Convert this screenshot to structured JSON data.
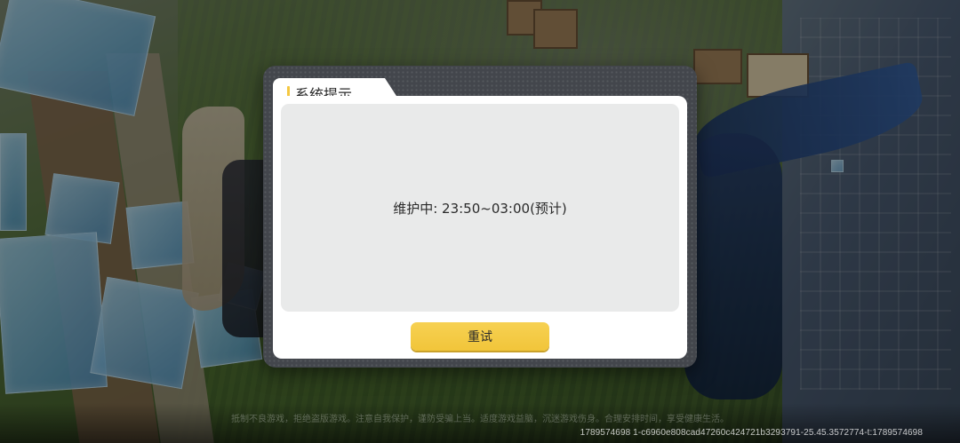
{
  "dialog": {
    "title": "系统提示",
    "message": "维护中: 23:50~03:00(预计)",
    "retry_label": "重试"
  },
  "footer": {
    "health_notice": "抵制不良游戏，拒绝盗版游戏。注意自我保护，谨防受骗上当。适度游戏益脑，沉迷游戏伤身。合理安排时间，享受健康生活。",
    "build_info": "1789574698  1-c6960e808cad47260c424721b3293791-25.45.3572774-t:1789574698"
  },
  "colors": {
    "accent": "#f5c842",
    "dialog_frame": "#43464c",
    "message_bg": "#e9eaea"
  },
  "icons": [
    "title-accent-marker"
  ]
}
